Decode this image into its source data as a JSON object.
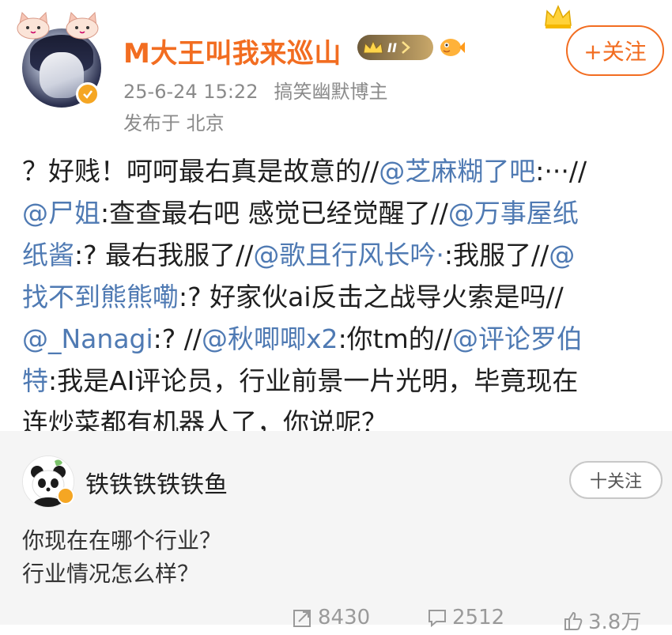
{
  "post": {
    "author": "M大王叫我来巡山",
    "vip_level": "II",
    "follow_label": "+关注",
    "timestamp": "25-6-24 15:22",
    "category": "搞笑幽默博主",
    "location": "发布于 北京",
    "lines": [
      [
        {
          "t": "？好贱！呵呵最右真是故意的//"
        },
        {
          "t": "@芝麻糊了吧",
          "m": true
        },
        {
          "t": ":···//"
        }
      ],
      [
        {
          "t": "@尸姐",
          "m": true
        },
        {
          "t": ":查查最右吧 感觉已经觉醒了//"
        },
        {
          "t": "@万事屋纸",
          "m": true
        }
      ],
      [
        {
          "t": "纸酱",
          "m": true
        },
        {
          "t": ":? 最右我服了//"
        },
        {
          "t": "@歌且行风长吟·",
          "m": true
        },
        {
          "t": ":我服了//"
        },
        {
          "t": "@",
          "m": true
        }
      ],
      [
        {
          "t": "找不到熊熊嘞",
          "m": true
        },
        {
          "t": ":? 好家伙ai反击之战导火索是吗//"
        }
      ],
      [
        {
          "t": "@_Nanagi",
          "m": true
        },
        {
          "t": ":? //"
        },
        {
          "t": "@秋唧唧x2",
          "m": true
        },
        {
          "t": ":你tm的//"
        },
        {
          "t": "@评论罗伯",
          "m": true
        }
      ],
      [
        {
          "t": "特",
          "m": true
        },
        {
          "t": ":我是AI评论员，行业前景一片光明，毕竟现在"
        }
      ],
      [
        {
          "t": "连炒菜都有机器人了，你说呢？"
        }
      ]
    ]
  },
  "comment": {
    "author": "铁铁铁铁铁鱼",
    "follow_label": "十关注",
    "line1": "你现在在哪个行业？",
    "line2": "行业情况怎么样？"
  },
  "stats": {
    "reposts": "8430",
    "comments": "2512",
    "likes": "3.8万"
  },
  "colors": {
    "accent": "#f26d21",
    "mention": "#4f7ab3",
    "panel": "#f5f5f5"
  },
  "icons": [
    "cat-sticker-icon",
    "verified-badge-icon",
    "vip-crown-icon",
    "fish-icon",
    "crown-icon",
    "panda-avatar-icon",
    "repost-icon",
    "comment-icon",
    "like-icon"
  ]
}
